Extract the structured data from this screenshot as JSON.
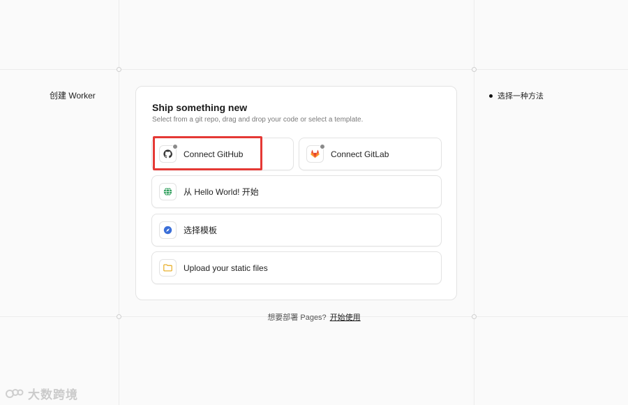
{
  "left_label": "创建 Worker",
  "right_steps": [
    "选择一种方法"
  ],
  "card": {
    "title": "Ship something new",
    "subtitle": "Select from a git repo, drag and drop your code or select a template."
  },
  "options": {
    "github": {
      "label": "Connect GitHub",
      "icon": "github-icon"
    },
    "gitlab": {
      "label": "Connect GitLab",
      "icon": "gitlab-icon"
    },
    "hello_world": {
      "label": "从 Hello World! 开始",
      "icon": "globe-icon"
    },
    "template": {
      "label": "选择模板",
      "icon": "compass-icon"
    },
    "upload": {
      "label": "Upload your static files",
      "icon": "folder-icon"
    }
  },
  "footer": {
    "text": "想要部署 Pages?",
    "link": "开始使用"
  },
  "watermark": "大数跨境",
  "colors": {
    "highlight": "#e53935",
    "gitlab": "#e24329",
    "globe": "#2e9e5b",
    "compass": "#3b6fd8",
    "folder": "#e6a817"
  }
}
